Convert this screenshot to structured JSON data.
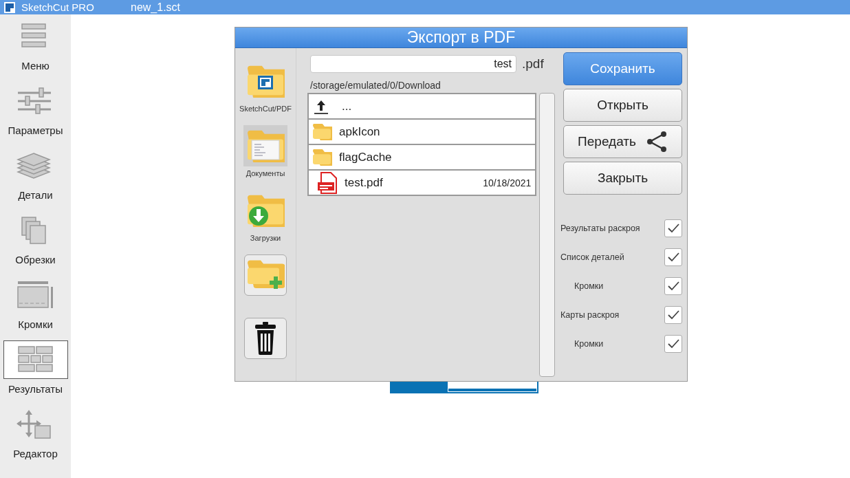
{
  "app": {
    "name": "SketchCut PRO",
    "file": "new_1.sct"
  },
  "sidebar": {
    "items": [
      {
        "label": "Меню",
        "selected": false
      },
      {
        "label": "Параметры",
        "selected": false
      },
      {
        "label": "Детали",
        "selected": false
      },
      {
        "label": "Обрезки",
        "selected": false
      },
      {
        "label": "Кромки",
        "selected": false
      },
      {
        "label": "Результаты",
        "selected": true
      },
      {
        "label": "Редактор",
        "selected": false
      }
    ]
  },
  "dialog": {
    "title": "Экспорт в PDF",
    "places": [
      {
        "label": "SketchCut/PDF",
        "selected": false
      },
      {
        "label": "Документы",
        "selected": true
      },
      {
        "label": "Загрузки",
        "selected": false
      }
    ],
    "filename": {
      "value": "test",
      "extension": ".pdf"
    },
    "path": "/storage/emulated/0/Download",
    "files": [
      {
        "kind": "up",
        "name": "..."
      },
      {
        "kind": "folder",
        "name": "apkIcon"
      },
      {
        "kind": "folder",
        "name": "flagCache"
      },
      {
        "kind": "pdf",
        "name": "test.pdf",
        "date": "10/18/2021"
      }
    ],
    "buttons": [
      {
        "label": "Сохранить",
        "selected": true,
        "kind": "plain"
      },
      {
        "label": "Открыть",
        "selected": false,
        "kind": "plain"
      },
      {
        "label": "Передать",
        "selected": false,
        "kind": "share"
      },
      {
        "label": "Закрыть",
        "selected": false,
        "kind": "plain"
      }
    ],
    "options": [
      {
        "label": "Результаты раскроя",
        "checked": true
      },
      {
        "label": "Список деталей",
        "checked": true,
        "children": [
          {
            "label": "Кромки",
            "checked": true
          }
        ]
      },
      {
        "label": "Карты раскроя",
        "checked": true,
        "children": [
          {
            "label": "Кромки",
            "checked": true
          }
        ]
      }
    ]
  }
}
